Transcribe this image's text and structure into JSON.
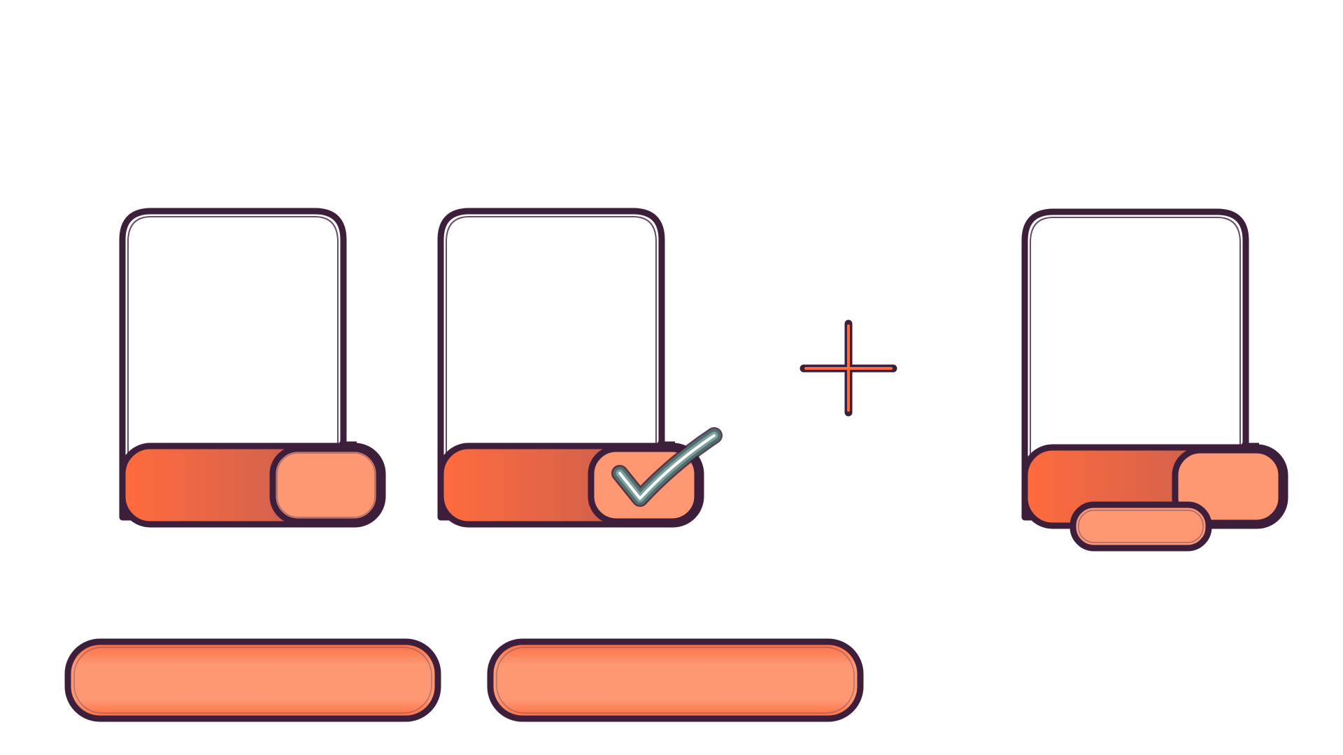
{
  "colors": {
    "outline": "#3d1f3c",
    "outline_light": "#6a4a6a",
    "frame_fill": "#ffffff",
    "accent_orange": "#ff6b3d",
    "accent_dark": "#a9504f",
    "accent_light": "#fd9873",
    "check_outer": "#4f6f6e",
    "check_mid": "#7da09c",
    "check_inner": "#ffffff",
    "background": "#ffffff"
  },
  "icons": {
    "left_device": "device-slider-icon",
    "middle_device": "device-slider-checked-icon",
    "plus": "plus-icon",
    "right_device": "device-slider-extra-icon",
    "check": "check-icon",
    "left_button": "pill-button",
    "right_button": "pill-button"
  },
  "states": {
    "middle_device_checked": true
  }
}
